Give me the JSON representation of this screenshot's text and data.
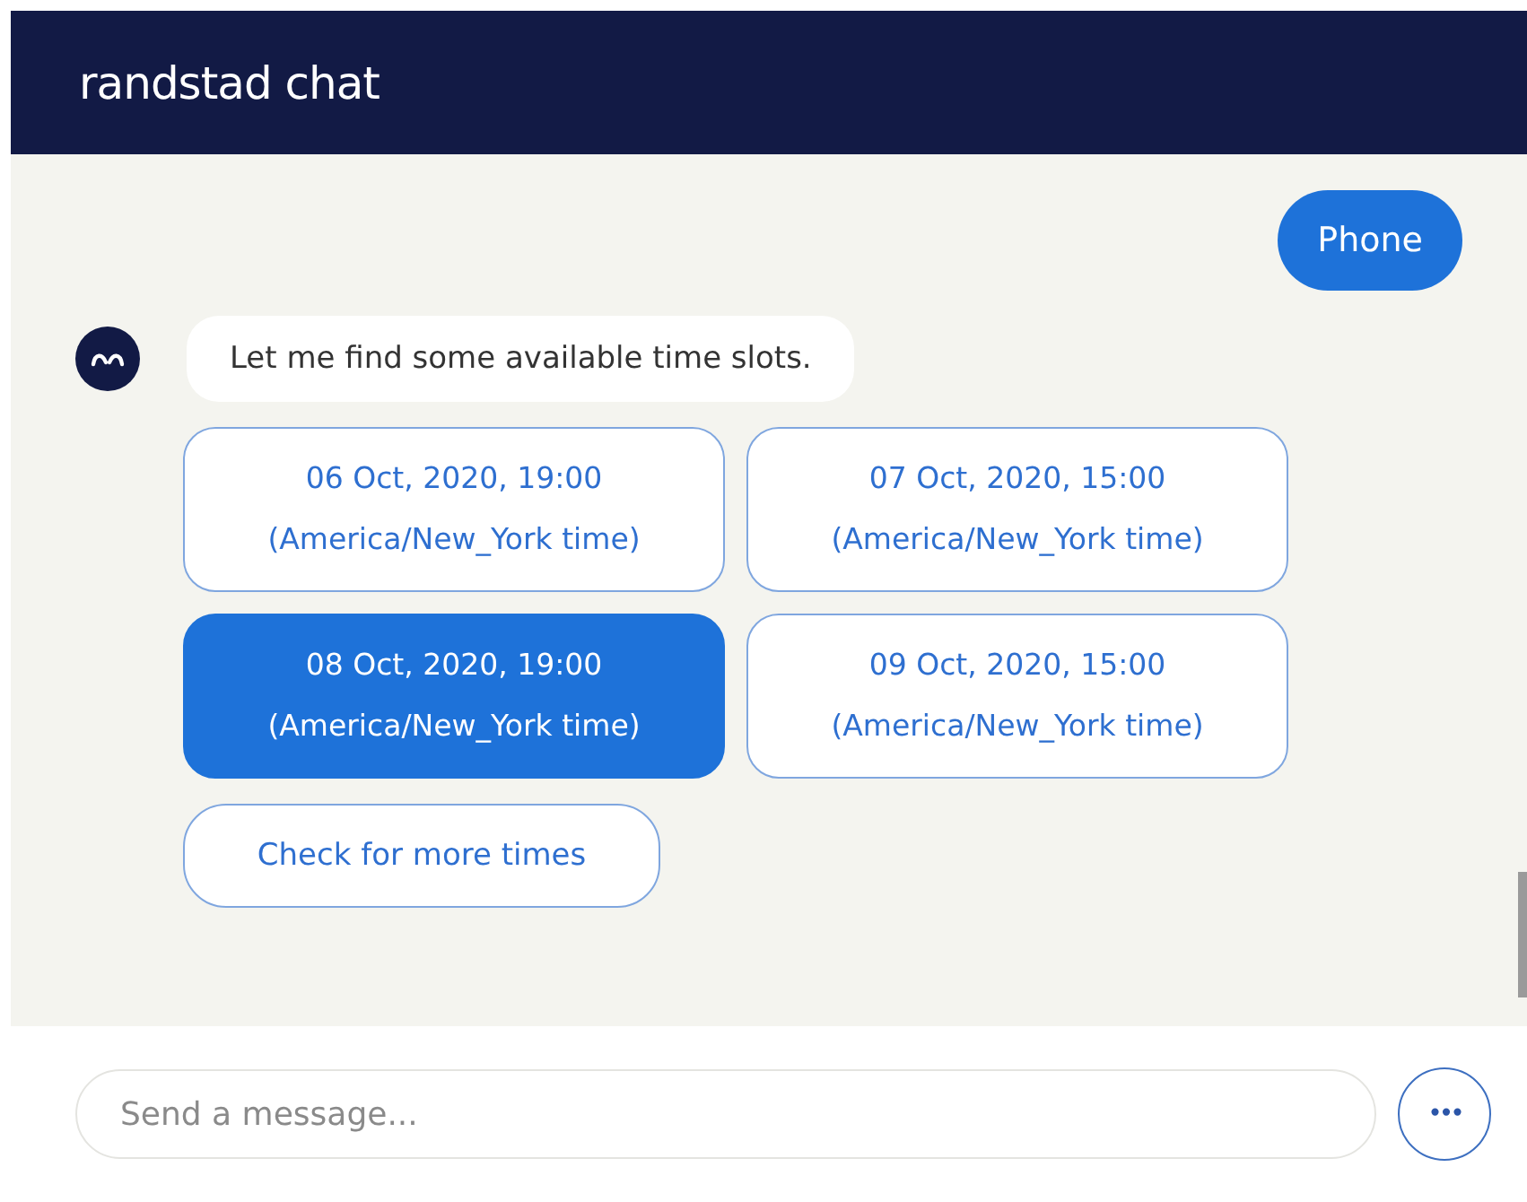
{
  "window": {
    "title": "randstad chat"
  },
  "messages": [
    {
      "kind": "user",
      "text": "Phone"
    },
    {
      "kind": "bot",
      "text": "Let me find some available time slots."
    }
  ],
  "time_slots": [
    {
      "date": "06 Oct, 2020, 19:00",
      "zone": "(America/New_York time)",
      "selected": false
    },
    {
      "date": "07 Oct, 2020, 15:00",
      "zone": "(America/New_York time)",
      "selected": false
    },
    {
      "date": "08 Oct, 2020, 19:00",
      "zone": "(America/New_York time)",
      "selected": true
    },
    {
      "date": "09 Oct, 2020, 15:00",
      "zone": "(America/New_York time)",
      "selected": false
    }
  ],
  "more_button": {
    "label": "Check for more times"
  },
  "composer": {
    "placeholder": "Send a message...",
    "menu_button": "•••"
  }
}
